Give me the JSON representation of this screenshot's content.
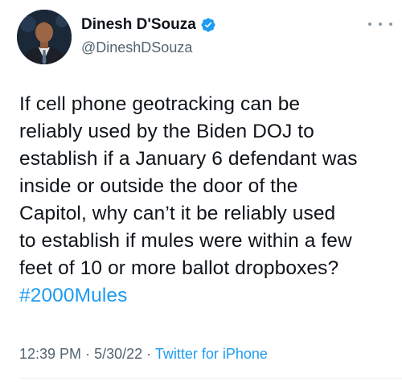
{
  "author": {
    "display_name": "Dinesh D'Souza",
    "handle": "@DineshDSouza",
    "verified": true
  },
  "tweet": {
    "lines": [
      "If cell phone geotracking can be",
      "reliably used by the Biden DOJ to",
      "establish if a January 6 defendant was",
      "inside or outside the door of the",
      "Capitol, why can’t it be reliably used",
      "to establish if mules were within a few",
      "feet of 10 or more ballot dropboxes?"
    ],
    "hashtag": "#2000Mules"
  },
  "meta": {
    "time": "12:39 PM",
    "separator": "·",
    "date": "5/30/22",
    "source": "Twitter for iPhone"
  },
  "icons": {
    "verified": "verified-badge-icon",
    "more": "more-options-icon"
  },
  "colors": {
    "accent": "#1d9bf0",
    "text": "#0f1419",
    "secondary": "#536471"
  }
}
